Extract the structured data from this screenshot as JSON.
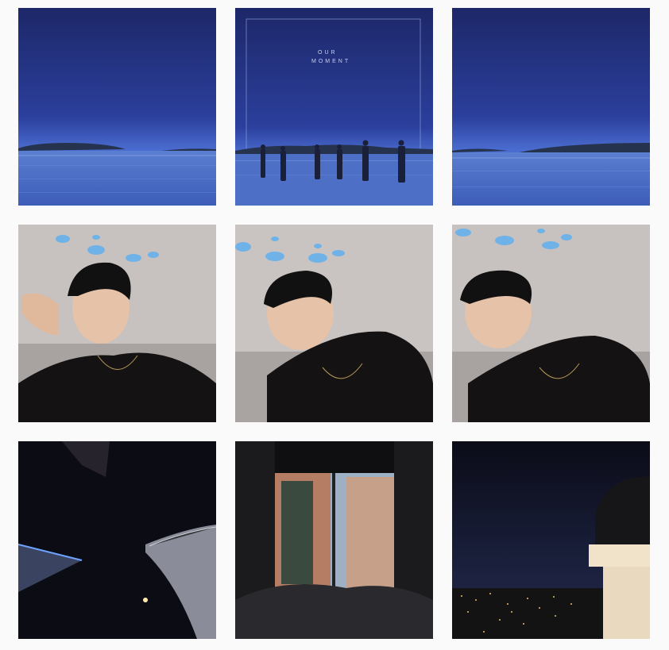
{
  "album_cover": {
    "line1": "OUR",
    "line2": "MOMENT"
  },
  "colors": {
    "night_sky_top": "#20296f",
    "night_sky_bottom": "#3a5bc4",
    "sea": "#4a6fc0",
    "selfie_wall": "#c7c2bf",
    "shirt": "#151314",
    "dark_sky": "#0b0c14"
  },
  "grid": {
    "tiles": [
      {
        "name": "post-beach-night-left",
        "icon": "photo"
      },
      {
        "name": "post-our-moment-cover",
        "icon": "photo"
      },
      {
        "name": "post-beach-night-right",
        "icon": "photo"
      },
      {
        "name": "post-selfie-peace",
        "icon": "photo"
      },
      {
        "name": "post-selfie-center",
        "icon": "photo"
      },
      {
        "name": "post-selfie-right",
        "icon": "photo"
      },
      {
        "name": "post-towers-night",
        "icon": "photo"
      },
      {
        "name": "post-window-city",
        "icon": "photo"
      },
      {
        "name": "post-observatory-view",
        "icon": "photo"
      }
    ]
  }
}
